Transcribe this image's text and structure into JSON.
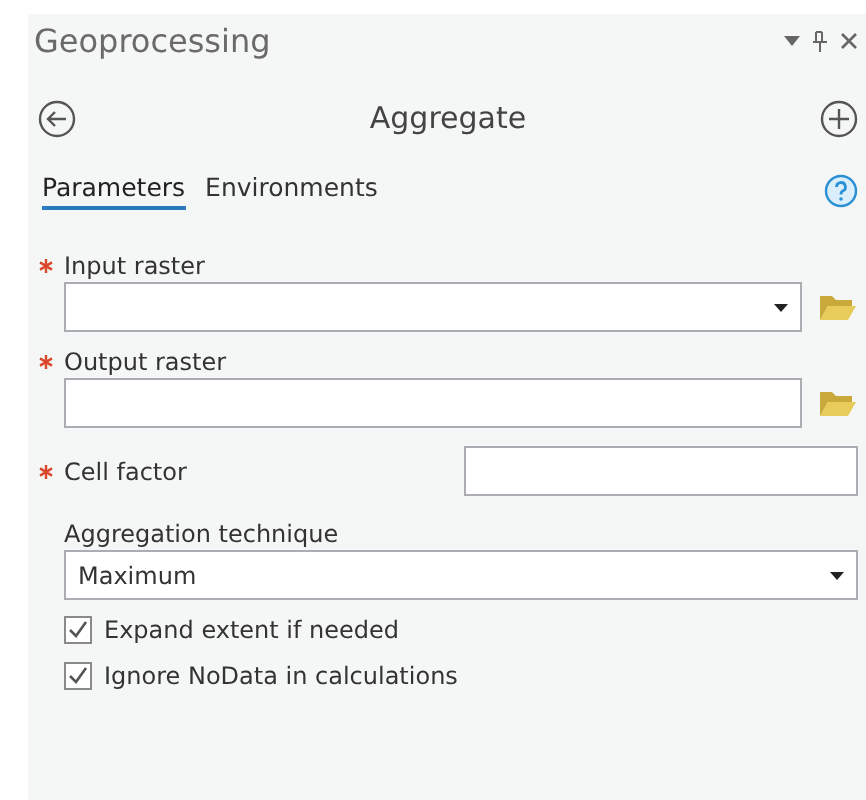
{
  "pane": {
    "title": "Geoprocessing"
  },
  "tool": {
    "title": "Aggregate"
  },
  "tabs": [
    {
      "label": "Parameters",
      "selected": true
    },
    {
      "label": "Environments",
      "selected": false
    }
  ],
  "parameters": [
    {
      "kind": "dataset",
      "label": "Input raster",
      "required": true,
      "dropdown": true
    },
    {
      "kind": "dataset",
      "label": "Output raster",
      "required": true,
      "dropdown": false
    },
    {
      "kind": "inline",
      "label": "Cell factor",
      "required": true
    },
    {
      "kind": "select",
      "label": "Aggregation technique",
      "required": false,
      "value": "Maximum"
    },
    {
      "kind": "checkbox",
      "label": "Expand extent if needed",
      "checked": true
    },
    {
      "kind": "checkbox",
      "label": "Ignore NoData in calculations",
      "checked": true
    }
  ]
}
